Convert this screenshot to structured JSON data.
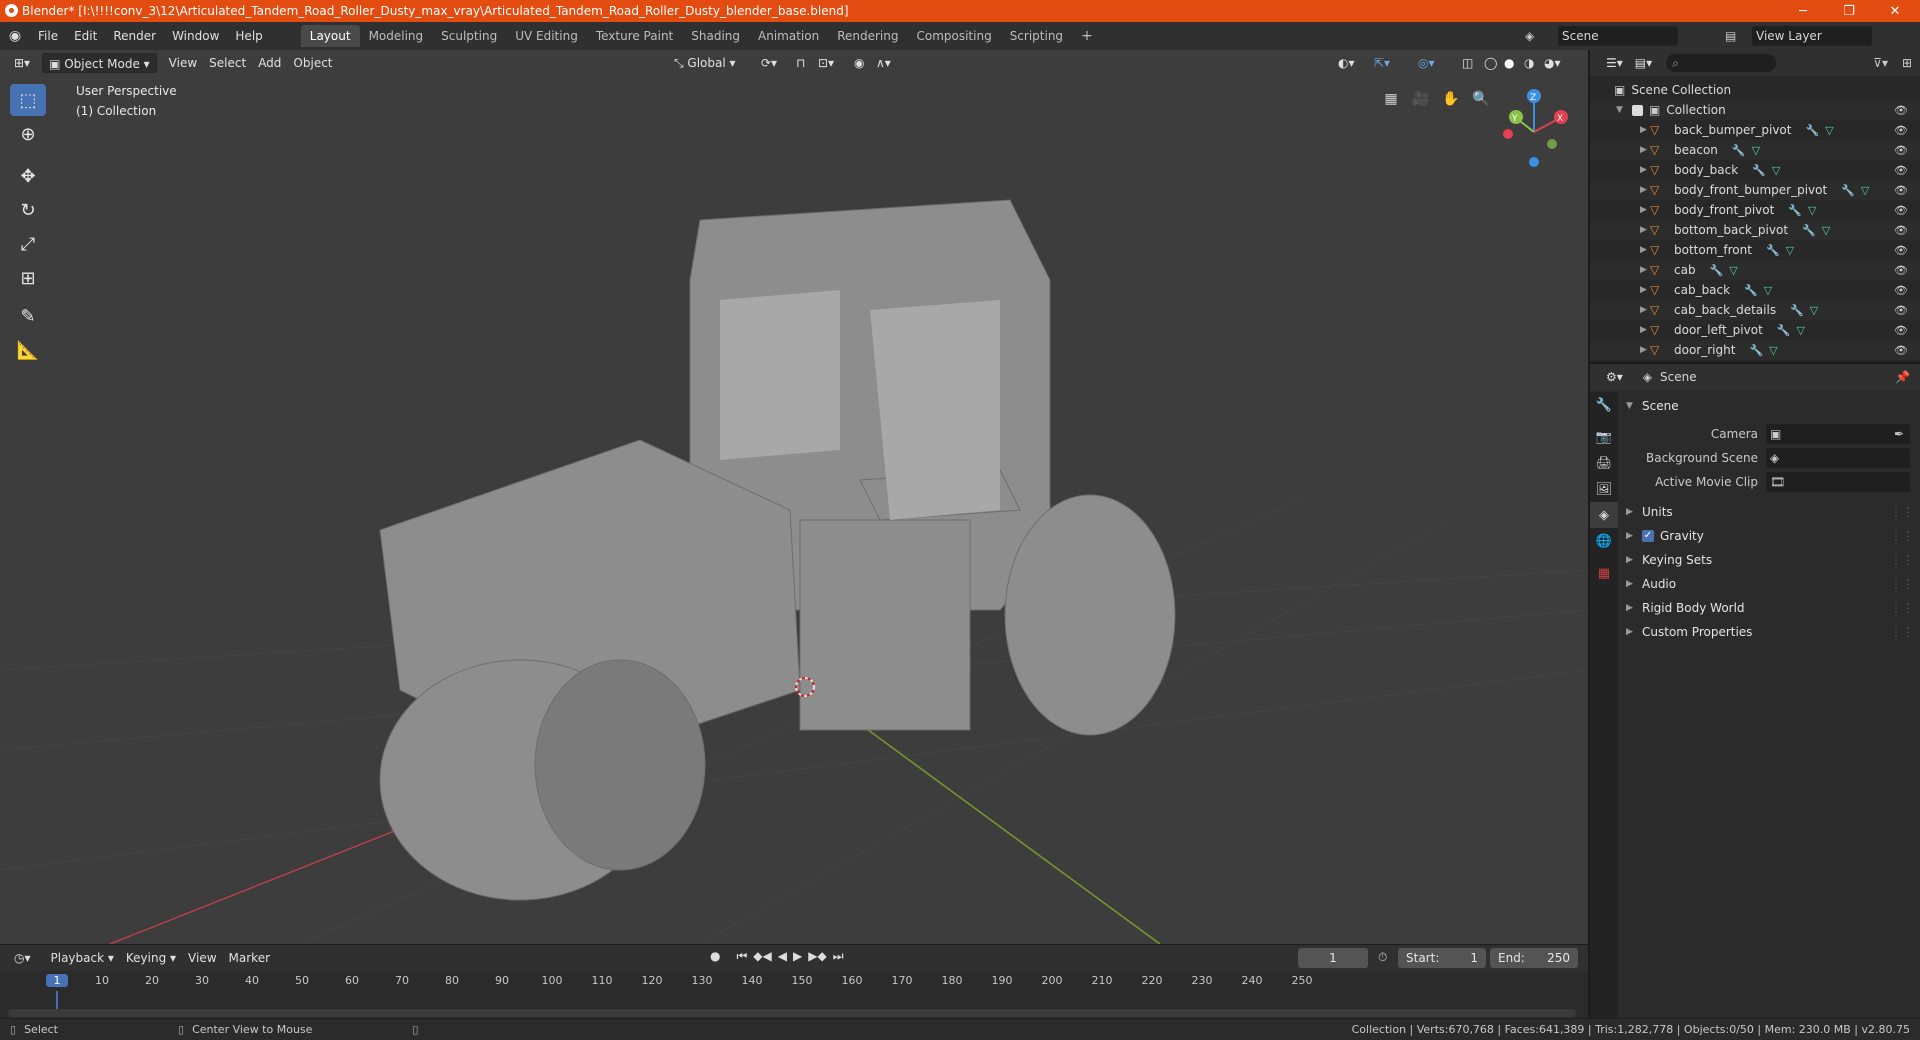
{
  "title_bar": {
    "title": "Blender* [I:\\!!!!conv_3\\12\\Articulated_Tandem_Road_Roller_Dusty_max_vray\\Articulated_Tandem_Road_Roller_Dusty_blender_base.blend]"
  },
  "menus": [
    "File",
    "Edit",
    "Render",
    "Window",
    "Help"
  ],
  "workspaces": [
    {
      "label": "Layout",
      "active": true
    },
    {
      "label": "Modeling"
    },
    {
      "label": "Sculpting"
    },
    {
      "label": "UV Editing"
    },
    {
      "label": "Texture Paint"
    },
    {
      "label": "Shading"
    },
    {
      "label": "Animation"
    },
    {
      "label": "Rendering"
    },
    {
      "label": "Compositing"
    },
    {
      "label": "Scripting"
    }
  ],
  "scene_selector": {
    "scene": "Scene",
    "view_layer": "View Layer"
  },
  "viewport": {
    "mode": "Object Mode",
    "menus": [
      "View",
      "Select",
      "Add",
      "Object"
    ],
    "transform_orientation": "Global",
    "info_line1": "User Perspective",
    "info_line2": "(1) Collection",
    "gizmo": {
      "z": "Z",
      "y": "Y",
      "x": "X"
    }
  },
  "outliner": {
    "root": "Scene Collection",
    "collection": "Collection",
    "items": [
      "back_bumper_pivot",
      "beacon",
      "body_back",
      "body_front_bumper_pivot",
      "body_front_pivot",
      "bottom_back_pivot",
      "bottom_front",
      "cab",
      "cab_back",
      "cab_back_details",
      "door_left_pivot",
      "door_right"
    ]
  },
  "properties": {
    "header": "Scene",
    "section": "Scene",
    "fields": [
      {
        "label": "Camera"
      },
      {
        "label": "Background Scene"
      },
      {
        "label": "Active Movie Clip"
      }
    ],
    "subsections": [
      {
        "label": "Units",
        "checkbox": false
      },
      {
        "label": "Gravity",
        "checkbox": true
      },
      {
        "label": "Keying Sets",
        "checkbox": false
      },
      {
        "label": "Audio",
        "checkbox": false
      },
      {
        "label": "Rigid Body World",
        "checkbox": false
      },
      {
        "label": "Custom Properties",
        "checkbox": false
      }
    ]
  },
  "timeline": {
    "menus": [
      "Playback",
      "Keying",
      "View",
      "Marker"
    ],
    "current_frame": "1",
    "start_label": "Start:",
    "start": "1",
    "end_label": "End:",
    "end": "250",
    "ticks": [
      "1",
      "10",
      "20",
      "30",
      "40",
      "50",
      "60",
      "70",
      "80",
      "90",
      "100",
      "110",
      "120",
      "130",
      "140",
      "150",
      "160",
      "170",
      "180",
      "190",
      "200",
      "210",
      "220",
      "230",
      "240",
      "250"
    ]
  },
  "status_bar": {
    "left1": "Select",
    "left2": "Center View to Mouse",
    "stats": "Collection | Verts:670,768 | Faces:641,389 | Tris:1,282,778 | Objects:0/50 | Mem: 230.0 MB | v2.80.75"
  },
  "colors": {
    "accent": "#4772b3",
    "titlebar": "#e24c10",
    "x_axis": "#e5404f",
    "y_axis": "#8bc34a",
    "z_axis": "#3d8fe6"
  }
}
